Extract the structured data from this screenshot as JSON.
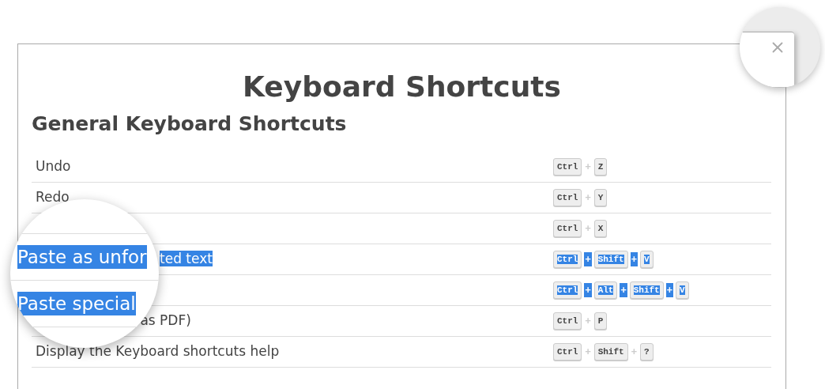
{
  "dialog": {
    "title": "Keyboard Shortcuts",
    "section": {
      "heading": "General Keyboard Shortcuts",
      "rows": [
        {
          "label": "Undo",
          "selected": false,
          "keys": [
            "Ctrl",
            "+",
            "Z"
          ]
        },
        {
          "label": "Redo",
          "selected": false,
          "keys": [
            "Ctrl",
            "+",
            "Y"
          ]
        },
        {
          "selected": false,
          "keys": [
            "Ctrl",
            "+",
            "X"
          ]
        },
        {
          "label": "ted text",
          "partial": true,
          "selected": true,
          "keys": [
            "Ctrl",
            "+",
            "Shift",
            "+",
            "V"
          ]
        },
        {
          "selected": true,
          "keys": [
            "Ctrl",
            "+",
            "Alt",
            "+",
            "Shift",
            "+",
            "V"
          ]
        },
        {
          "label": "as PDF)",
          "partial": true,
          "selected": false,
          "keys": [
            "Ctrl",
            "+",
            "P"
          ]
        },
        {
          "label": "Display the Keyboard shortcuts help",
          "selected": false,
          "keys": [
            "Ctrl",
            "+",
            "Shift",
            "+",
            "?"
          ]
        }
      ]
    }
  },
  "magnifier": {
    "lines": [
      {
        "text": "Paste as unfor",
        "selected": true
      },
      {
        "text": "Paste special",
        "selected": true
      }
    ]
  }
}
